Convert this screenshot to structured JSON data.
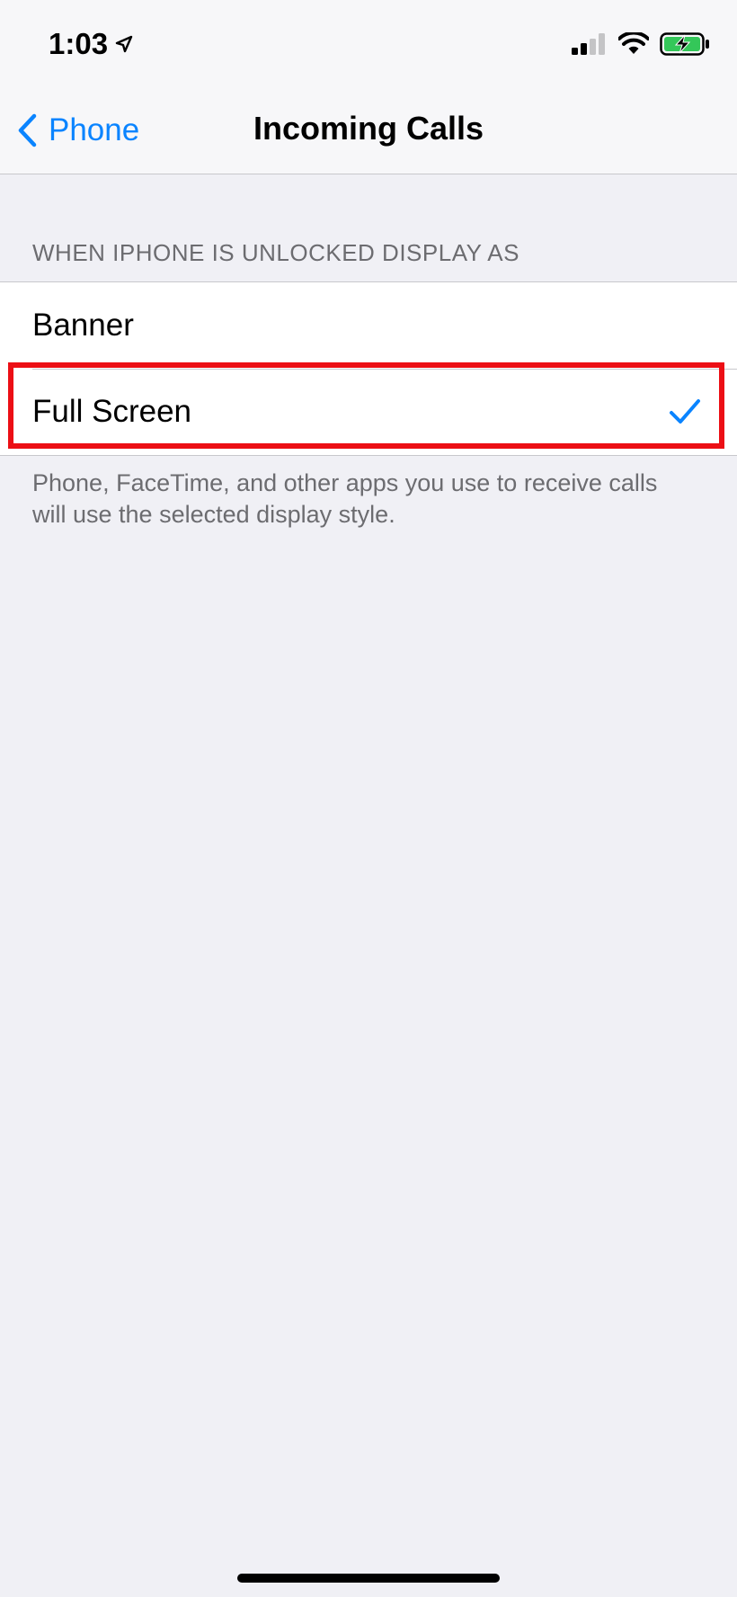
{
  "status_bar": {
    "time": "1:03",
    "location_icon": "location-arrow-icon",
    "signal_icon": "cellular-signal-icon",
    "wifi_icon": "wifi-icon",
    "battery_icon": "battery-charging-icon",
    "battery_color": "#34c759"
  },
  "nav": {
    "back_label": "Phone",
    "title": "Incoming Calls",
    "back_icon": "chevron-left-icon"
  },
  "section": {
    "header": "WHEN IPHONE IS UNLOCKED DISPLAY AS",
    "options": [
      {
        "label": "Banner",
        "selected": false
      },
      {
        "label": "Full Screen",
        "selected": true
      }
    ],
    "footer": "Phone, FaceTime, and other apps you use to receive calls will use the selected display style."
  },
  "colors": {
    "accent": "#0a84ff",
    "highlight": "#ec0f15",
    "background": "#f0f0f5"
  }
}
